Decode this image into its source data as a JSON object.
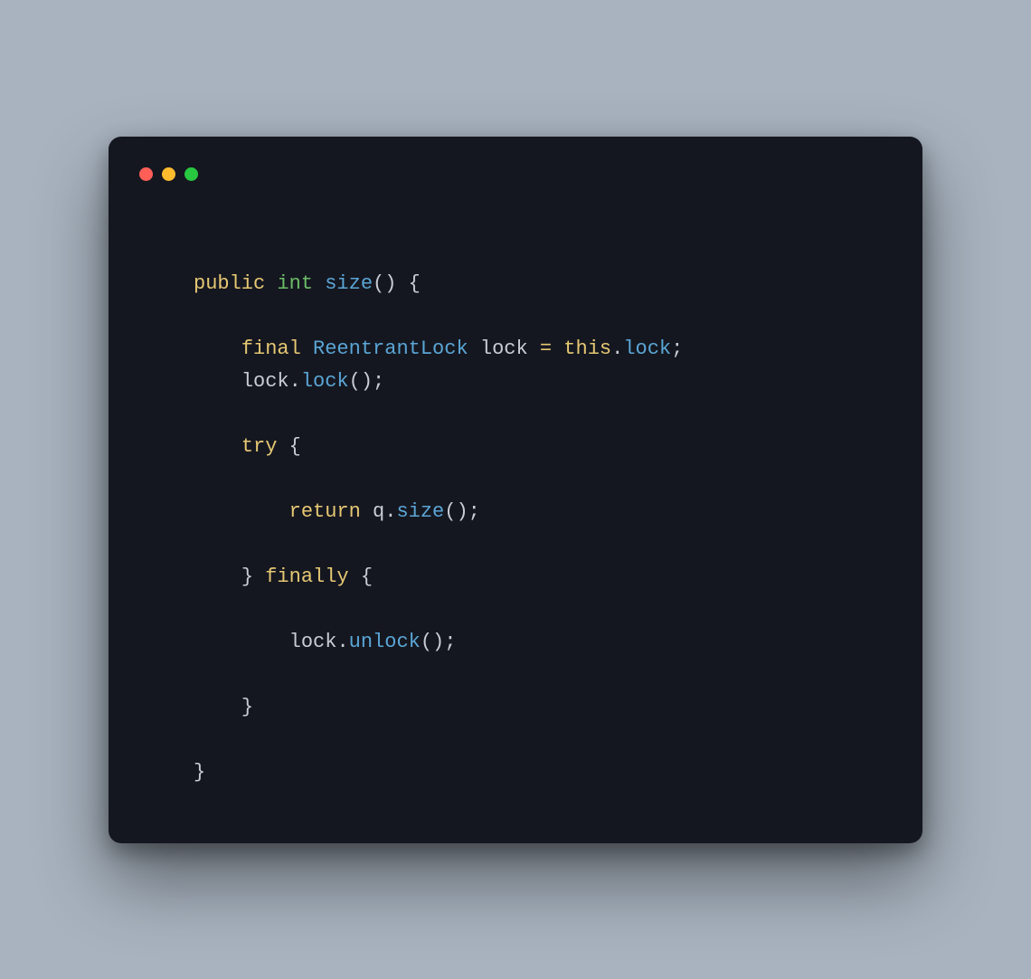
{
  "traffic": {
    "red": "#ff5f57",
    "yellow": "#febc2e",
    "green": "#28c840"
  },
  "code": {
    "tokens": [
      {
        "t": "keyword",
        "v": "public"
      },
      {
        "t": "sp",
        "v": " "
      },
      {
        "t": "type",
        "v": "int"
      },
      {
        "t": "sp",
        "v": " "
      },
      {
        "t": "func",
        "v": "size"
      },
      {
        "t": "punct",
        "v": "()"
      },
      {
        "t": "sp",
        "v": " "
      },
      {
        "t": "punct",
        "v": "{"
      },
      {
        "t": "nl",
        "v": "\n"
      },
      {
        "t": "nl",
        "v": "\n"
      },
      {
        "t": "sp",
        "v": "    "
      },
      {
        "t": "keyword",
        "v": "final"
      },
      {
        "t": "sp",
        "v": " "
      },
      {
        "t": "func",
        "v": "ReentrantLock"
      },
      {
        "t": "sp",
        "v": " "
      },
      {
        "t": "ident",
        "v": "lock"
      },
      {
        "t": "sp",
        "v": " "
      },
      {
        "t": "op",
        "v": "="
      },
      {
        "t": "sp",
        "v": " "
      },
      {
        "t": "keyword",
        "v": "this"
      },
      {
        "t": "punct",
        "v": "."
      },
      {
        "t": "func",
        "v": "lock"
      },
      {
        "t": "punct",
        "v": ";"
      },
      {
        "t": "nl",
        "v": "\n"
      },
      {
        "t": "sp",
        "v": "    "
      },
      {
        "t": "ident",
        "v": "lock"
      },
      {
        "t": "punct",
        "v": "."
      },
      {
        "t": "func",
        "v": "lock"
      },
      {
        "t": "punct",
        "v": "();"
      },
      {
        "t": "nl",
        "v": "\n"
      },
      {
        "t": "nl",
        "v": "\n"
      },
      {
        "t": "sp",
        "v": "    "
      },
      {
        "t": "keyword",
        "v": "try"
      },
      {
        "t": "sp",
        "v": " "
      },
      {
        "t": "punct",
        "v": "{"
      },
      {
        "t": "nl",
        "v": "\n"
      },
      {
        "t": "nl",
        "v": "\n"
      },
      {
        "t": "sp",
        "v": "        "
      },
      {
        "t": "keyword",
        "v": "return"
      },
      {
        "t": "sp",
        "v": " "
      },
      {
        "t": "ident",
        "v": "q"
      },
      {
        "t": "punct",
        "v": "."
      },
      {
        "t": "func",
        "v": "size"
      },
      {
        "t": "punct",
        "v": "();"
      },
      {
        "t": "nl",
        "v": "\n"
      },
      {
        "t": "nl",
        "v": "\n"
      },
      {
        "t": "sp",
        "v": "    "
      },
      {
        "t": "punct",
        "v": "}"
      },
      {
        "t": "sp",
        "v": " "
      },
      {
        "t": "keyword",
        "v": "finally"
      },
      {
        "t": "sp",
        "v": " "
      },
      {
        "t": "punct",
        "v": "{"
      },
      {
        "t": "nl",
        "v": "\n"
      },
      {
        "t": "nl",
        "v": "\n"
      },
      {
        "t": "sp",
        "v": "        "
      },
      {
        "t": "ident",
        "v": "lock"
      },
      {
        "t": "punct",
        "v": "."
      },
      {
        "t": "func",
        "v": "unlock"
      },
      {
        "t": "punct",
        "v": "();"
      },
      {
        "t": "nl",
        "v": "\n"
      },
      {
        "t": "nl",
        "v": "\n"
      },
      {
        "t": "sp",
        "v": "    "
      },
      {
        "t": "punct",
        "v": "}"
      },
      {
        "t": "nl",
        "v": "\n"
      },
      {
        "t": "nl",
        "v": "\n"
      },
      {
        "t": "punct",
        "v": "}"
      }
    ]
  }
}
